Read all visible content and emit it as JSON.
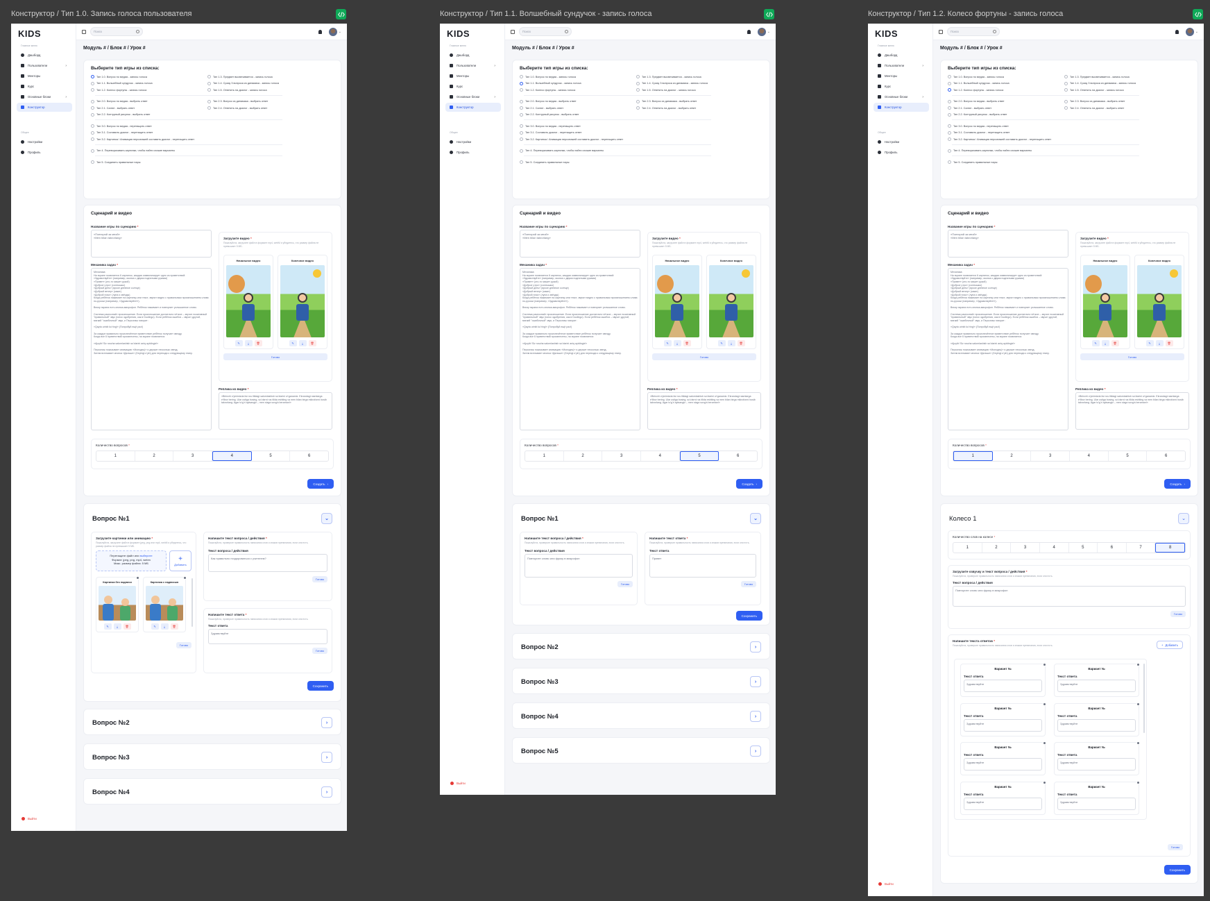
{
  "common": {
    "logo": "KIDS",
    "search_placeholder": "Поиск",
    "section_main": "Главное меню",
    "section_general": "Общее",
    "nav_main": [
      "Дашборд",
      "Пользователи",
      "Менторы",
      "Курс",
      "Основные блоки",
      "Конструктор"
    ],
    "nav_general": [
      "Настройки",
      "Профиль"
    ],
    "logout": "Выйти",
    "breadcrumb": "Модуль # / Блок # / Урок #",
    "choose_type_title": "Выберите тип игры из списка:",
    "types_left": [
      "Тип 1.0. Вопрос по медиа - запись голоса",
      "Тип 1.1. Волшебный сундучок - запись голоса",
      "Тип 1.2. Колесо фортуны - запись голоса",
      "Тип 2.0. Вопрос по медиа - выбрать ответ",
      "Тип 2.1. Салют - выбрать ответ",
      "Тип 2.2. Контурный рисунок - выбрать ответ",
      "Тип 3.0. Вопрос по медиа - перетащить ответ",
      "Тип 3.1. Составить диалог - перетащить ответ",
      "Тип 3.2. Картинка / Анимация персонажей составить диалог - перетащить ответ",
      "Тип 4. Переворачивать картинки, чтобы найти схожие варианты",
      "Тип 5. Соединить правильные пары"
    ],
    "types_right": [
      "Тип 1.3. Предмет высвечивается - запись голоса",
      "Тип 1.4. Сразу 3 вопроса из динамика - запись голоса",
      "Тип 1.5. Ответить на диалог - запись голоса",
      "Тип 2.3. Вопрос из динамика - выбрать ответ",
      "Тип 2.4. Ответить на диалог - выбрать ответ"
    ],
    "scenario_title": "Сценарий и видео",
    "game_name_label": "Название игры по сценарию",
    "game_name_value": "«Повторяй за мной»\n«Men bilan takrorlang»",
    "mechanics_label": "Механика задач",
    "mechanics_value": "Механика:\nНа экране появляется 6 картинок, каждая символизирует одно из приветствий:\n«Здравствуйте» (например, иконка с двумя поднятыми руками)\n«Привет» (кто-то машет рукой)\n«Доброе утро» (солнышко)\n«Добрый день» (яркое дневное солнце)\n«Добрый вечер» (закат)\n«Доброй ночи» (луна и звёзды)\nКогда ребёнок нажимает на картинку или текст, звучит видео с правильным произношением слова по-русски (например, «Здравствуйте!»).\n\nВнизу экрана есть кнопка-микрофон. Ребёнок нажимает и повторяет услышанное слово.\n\nСистема распознаёт произношение. Если произношение достаточно чёткое – звучит позитивный \"правильный\" звук (голос одобрения, как в Duolingo). Если ребёнок ошибся – звучит другой, мягкий \"ошибочный\" звук, и Персонаж говорит:\n\n«Qayta urinib ko'ring!» (Попробуй ещё раз!)\n\nЗа каждое правильно произнесённое приветствие ребёнок получает звезду.\nКогда все 6 приветствий произнесены, на экране появляется:\n\n«Ajoyib! Siz ruscha salomlashish so'zlarini aniq aytdingiz!»\n\nПерсонаж показывает анимацию «Молодец!» и держит несколько звезд.\nЗатем всплывает кнопка «Дальше» (Keyingi o'yin) для перехода к следующему этапу.",
    "upload_video_label": "Загрузите видео",
    "upload_video_hint": "Пожалуйста, загрузите файл в формате mp4, webM и убедитесь, что размер файла не превышает 5 МБ.",
    "start_video": "Начальное видео",
    "end_video": "Конечное видео",
    "ready": "Готово",
    "replica_label": "Реплика из видео",
    "replica_value": "«Birinchi o'yinimizda biz rus tilidagi salomlashish so'zlarini o'rganamiz. Ekrandagi rasmlarga e'tibor bering. Ular ustiga bosing, so'zlarni rus tilida eshiting va men bilan birga mikrofonni bosib takrorlang. Agar to'g'ri aytsangiz – men sizga sovg'a beraman!»",
    "questions_count_label": "Количество вопросов",
    "questions_count_options": [
      "1",
      "2",
      "3",
      "4",
      "5",
      "6"
    ],
    "create_button": "Создать",
    "save_button": "Сохранить",
    "answer_placeholder": "Здравствуйте",
    "question_placeholder": "Как правильно поздороваться с учителем?",
    "voice_placeholder": "Повторите слово или фразу в микрофон",
    "question_text_label": "Текст вопроса / действия",
    "answer_text_label": "Текст ответа",
    "write_question_label": "Напишите текст вопроса / действия",
    "write_answer_label": "Напишите текст ответа",
    "write_hint": "Пожалуйста, проверьте правильность написания слов и знаков препинания, если они есть."
  },
  "frames": [
    {
      "title": "Конструктор / Тип 1.0. Запись голоса пользователя",
      "selected_type": "Тип 1.0. Вопрос по медиа - запись голоса",
      "selected_count": "4",
      "q1_title": "Вопрос №1",
      "upload_image_label": "Загрузите картинки или анимацию",
      "upload_image_hint": "Пожалуйста, загрузите файл в формате jpeg, png или mp4, webM и убедитесь, что размер файла не превышает 5 МБ.",
      "drop_text": "Перетащите файл или",
      "drop_link": "выберите",
      "drop_formats": "Формат: jpeg, png, mp4, webm",
      "drop_size": "Макс. размер файла: 5 МБ",
      "add_label": "Добавить",
      "pic1": "Картинка без надписи",
      "pic2": "Картинка с надписью",
      "collapsed": [
        "Вопрос №2",
        "Вопрос №3",
        "Вопрос №4"
      ]
    },
    {
      "title": "Конструктор / Тип 1.1. Волшебный сундучок - запись голоса",
      "selected_type": "Тип 1.1. Волшебный сундучок - запись голоса",
      "selected_count": "5",
      "q1_title": "Вопрос №1",
      "answer_value": "Привет",
      "collapsed": [
        "Вопрос №2",
        "Вопрос №3",
        "Вопрос №4",
        "Вопрос №5"
      ]
    },
    {
      "title": "Конструктор / Тип 1.2. Колесо фортуны - запись голоса",
      "selected_type": "Тип 1.2. Колесо фортуны - запись голоса",
      "selected_count": "1",
      "wheel_title": "Колесо 1",
      "words_count_label": "Количество слов на колесе",
      "words_count_options": [
        "1",
        "2",
        "3",
        "4",
        "5",
        "6",
        "7",
        "8"
      ],
      "words_selected": "8",
      "voice_label": "Загрузите озвучку и текст вопроса / действия",
      "answers_label": "Напишите текста ответов",
      "variant_label": "Вариант №",
      "add_label": "Добавить"
    }
  ],
  "colors": {
    "accent": "#2f5ef2",
    "danger": "#e53935",
    "code_badge": "#0fa958"
  }
}
